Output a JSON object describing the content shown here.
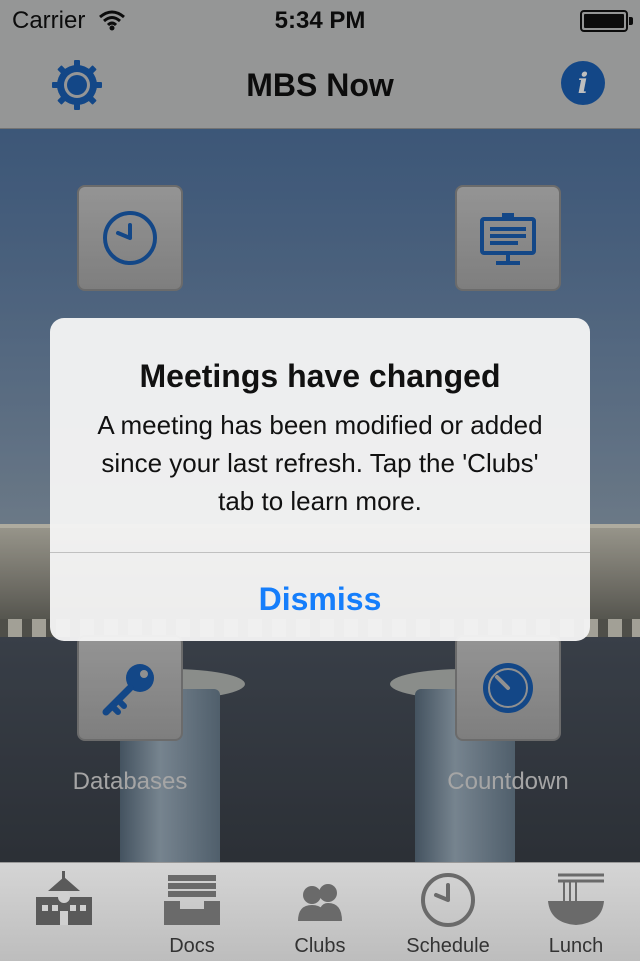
{
  "status_bar": {
    "carrier": "Carrier",
    "time": "5:34 PM"
  },
  "nav": {
    "title": "MBS Now",
    "left_icon": "gear-icon",
    "right_icon": "info-icon"
  },
  "tiles": [
    {
      "name": "online-schedule",
      "label": "",
      "icon": "clock-icon"
    },
    {
      "name": "presentation",
      "label": "",
      "icon": "presentation-icon"
    },
    {
      "name": "databases",
      "label": "Databases",
      "icon": "key-icon"
    },
    {
      "name": "countdown",
      "label": "Countdown",
      "icon": "timer-icon"
    }
  ],
  "alert": {
    "title": "Meetings have changed",
    "message": "A meeting has been modified or added since your last refresh. Tap the 'Clubs' tab to learn more.",
    "button": "Dismiss"
  },
  "tabbar": {
    "items": [
      {
        "label": "",
        "icon": "school-icon"
      },
      {
        "label": "Docs",
        "icon": "docs-tray-icon"
      },
      {
        "label": "Clubs",
        "icon": "people-icon"
      },
      {
        "label": "Schedule",
        "icon": "clock-icon"
      },
      {
        "label": "Lunch",
        "icon": "noodle-bowl-icon"
      }
    ]
  },
  "colors": {
    "accent": "#157efb",
    "icon_blue": "#1a5fb4"
  }
}
